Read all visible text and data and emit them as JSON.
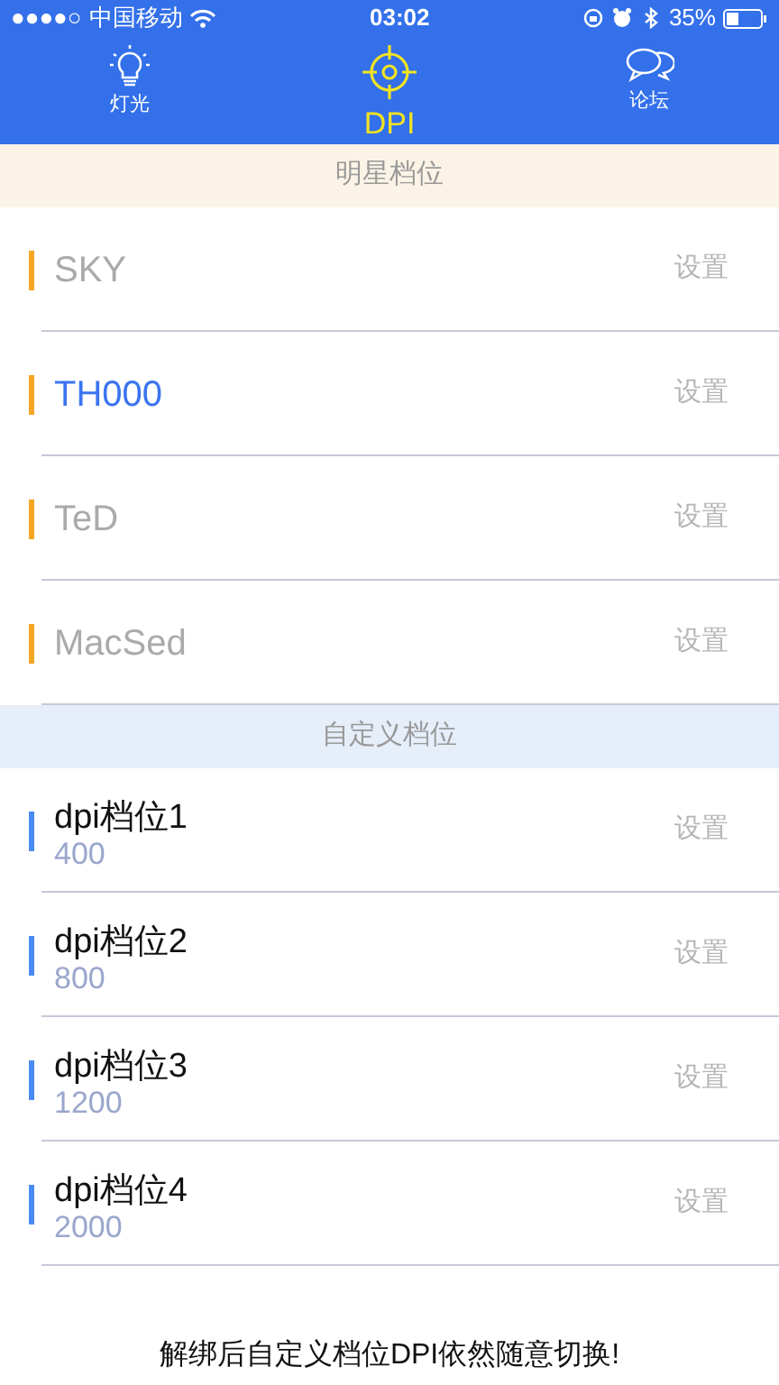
{
  "status_bar": {
    "signal": "●●●●○",
    "carrier": "中国移动",
    "time": "03:02",
    "battery": "35%"
  },
  "tabs": [
    {
      "label": "灯光",
      "kind": "bulb",
      "selected": false
    },
    {
      "label": "DPI",
      "kind": "target",
      "selected": true
    },
    {
      "label": "论坛",
      "kind": "chat",
      "selected": false
    }
  ],
  "sections": [
    {
      "title": "明星档位",
      "kind": "star",
      "items": [
        {
          "name": "SKY",
          "selected": false,
          "action": "设置"
        },
        {
          "name": "TH000",
          "selected": true,
          "action": "设置"
        },
        {
          "name": "TeD",
          "selected": false,
          "action": "设置"
        },
        {
          "name": "MacSed",
          "selected": false,
          "action": "设置"
        }
      ]
    },
    {
      "title": "自定义档位",
      "kind": "custom",
      "items": [
        {
          "name": "dpi档位1",
          "value": "400",
          "action": "设置"
        },
        {
          "name": "dpi档位2",
          "value": "800",
          "action": "设置"
        },
        {
          "name": "dpi档位3",
          "value": "1200",
          "action": "设置"
        },
        {
          "name": "dpi档位4",
          "value": "2000",
          "action": "设置"
        }
      ]
    }
  ],
  "footer": "解绑后自定义档位DPI依然随意切换!"
}
